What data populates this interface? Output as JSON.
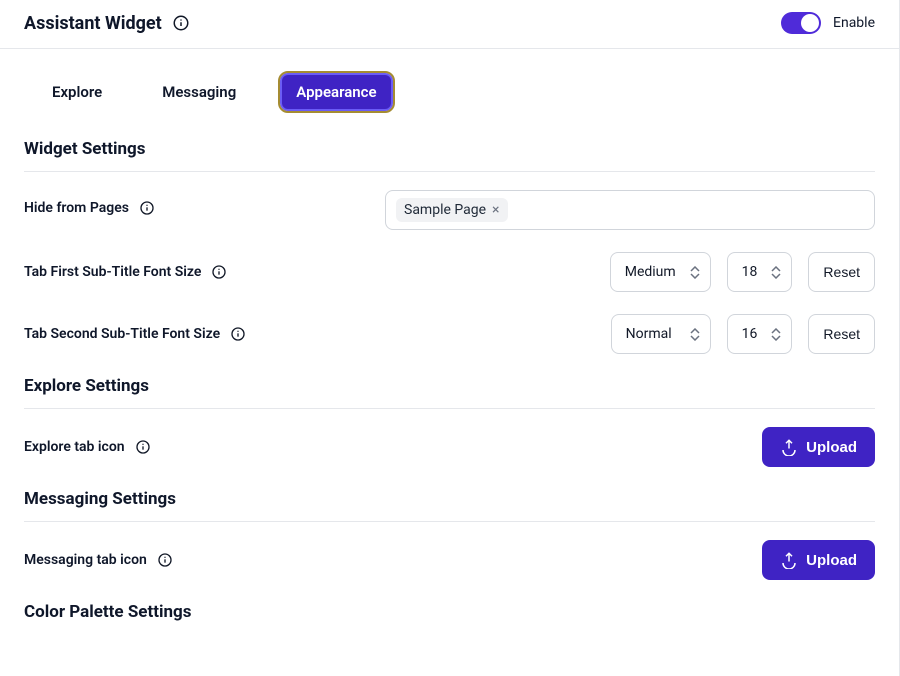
{
  "header": {
    "title": "Assistant Widget",
    "enable_label": "Enable",
    "enabled": true
  },
  "tabs": [
    {
      "label": "Explore",
      "active": false
    },
    {
      "label": "Messaging",
      "active": false
    },
    {
      "label": "Appearance",
      "active": true
    }
  ],
  "widget_settings": {
    "title": "Widget Settings",
    "hide_from_pages": {
      "label": "Hide from Pages",
      "chips": [
        {
          "text": "Sample Page"
        }
      ]
    },
    "tab_first": {
      "label": "Tab First Sub-Title Font Size",
      "select_value": "Medium",
      "number_value": "18",
      "reset_label": "Reset"
    },
    "tab_second": {
      "label": "Tab Second Sub-Title Font Size",
      "select_value": "Normal",
      "number_value": "16",
      "reset_label": "Reset"
    }
  },
  "explore_settings": {
    "title": "Explore Settings",
    "icon_row": {
      "label": "Explore tab icon",
      "upload_label": "Upload"
    }
  },
  "messaging_settings": {
    "title": "Messaging Settings",
    "icon_row": {
      "label": "Messaging tab icon",
      "upload_label": "Upload"
    }
  },
  "color_palette": {
    "title": "Color Palette Settings"
  }
}
